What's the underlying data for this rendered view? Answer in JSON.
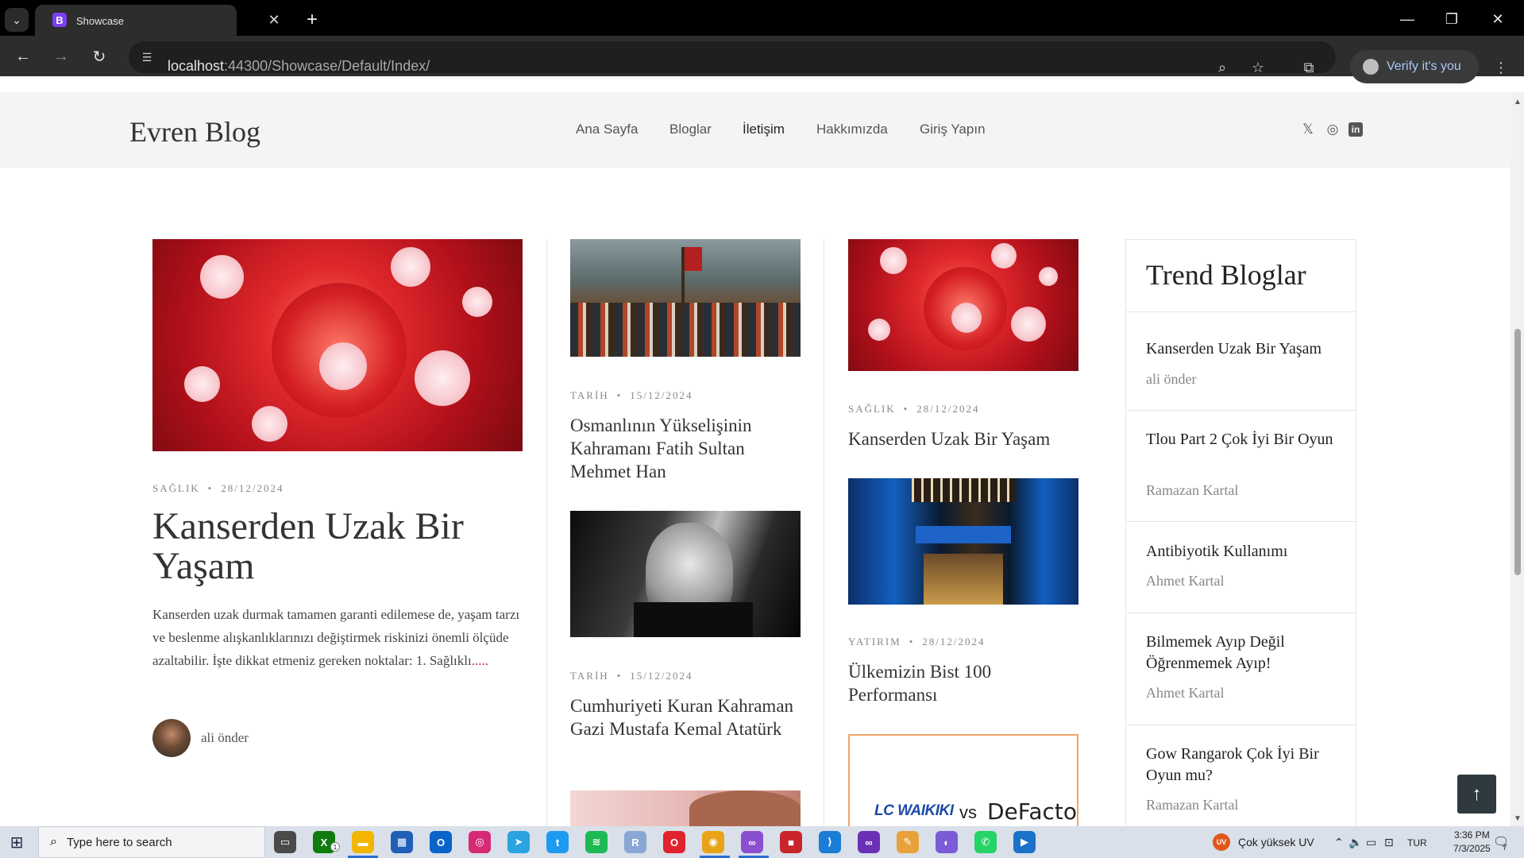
{
  "browser": {
    "tab_title": "Showcase",
    "tab_favicon": "B",
    "url_host": "localhost",
    "url_rest": ":44300/Showcase/Default/Index/",
    "verify_label": "Verify it's you",
    "icons": [
      "tab-search-icon",
      "close-icon",
      "new-tab-icon",
      "minimize-icon",
      "restore-icon",
      "window-close-icon",
      "back-icon",
      "forward-icon",
      "reload-icon",
      "site-info-icon",
      "zoom-icon",
      "bookmark-star-icon",
      "extensions-icon",
      "kebab-menu-icon"
    ]
  },
  "site": {
    "logo": "Evren Blog",
    "menu": [
      "Ana Sayfa",
      "Bloglar",
      "İletişim",
      "Hakkımızda",
      "Giriş Yapın"
    ],
    "social_icons": [
      "x-twitter-icon",
      "instagram-icon",
      "linkedin-icon"
    ]
  },
  "featured": {
    "category": "SAĞLIK",
    "date": "28/12/2024",
    "title": "Kanserden Uzak Bir Yaşam",
    "excerpt": "Kanserden uzak durmak tamamen garanti edilemese de, yaşam tarzı ve beslenme alışkanlıklarınızı değiştirmek riskinizi önemli ölçüde azaltabilir. İşte dikkat etmeniz gereken noktalar: 1. Sağlıklı",
    "more": ".....",
    "author": "ali önder"
  },
  "col2": [
    {
      "category": "TARİH",
      "date": "15/12/2024",
      "title": "Osmanlının Yükselişinin Kahramanı Fatih Sultan Mehmet Han"
    },
    {
      "category": "TARİH",
      "date": "15/12/2024",
      "title": "Cumhuriyeti Kuran Kahraman Gazi Mustafa Kemal Atatürk"
    }
  ],
  "col3": [
    {
      "category": "SAĞLIK",
      "date": "28/12/2024",
      "title": "Kanserden Uzak Bir Yaşam"
    },
    {
      "category": "YATIRIM",
      "date": "28/12/2024",
      "title": "Ülkemizin Bist 100 Performansı"
    }
  ],
  "ad": {
    "left": "LC WAIKIKI",
    "vs": "vs",
    "right": "DeFacto"
  },
  "sidebar": {
    "title": "Trend Bloglar",
    "posts": [
      {
        "title": "Kanserden Uzak Bir Yaşam",
        "author": "ali önder"
      },
      {
        "title": "Tlou Part 2 Çok İyi Bir Oyun",
        "author": "Ramazan Kartal"
      },
      {
        "title": "Antibiyotik Kullanımı",
        "author": "Ahmet Kartal"
      },
      {
        "title": "Bilmemek Ayıp Değil Öğrenmemek Ayıp!",
        "author": "Ahmet Kartal"
      },
      {
        "title": "Gow Rangarok Çok İyi Bir Oyun mu?",
        "author": "Ramazan Kartal"
      }
    ]
  },
  "taskbar": {
    "search_placeholder": "Type here to search",
    "uv_badge": "UV",
    "uv_text": "Çok yüksek UV",
    "lang": "TUR",
    "time": "3:36 PM",
    "date": "7/3/2025",
    "notif_count": "7",
    "xbox_badge": "1",
    "apps": [
      {
        "name": "task-view-icon",
        "color": "#4a4a4a",
        "glyph": "▭"
      },
      {
        "name": "xbox-icon",
        "color": "#107c10",
        "glyph": "X"
      },
      {
        "name": "file-explorer-icon",
        "color": "#f2b600",
        "glyph": "▬"
      },
      {
        "name": "store-icon",
        "color": "#1f5fb8",
        "glyph": "▦"
      },
      {
        "name": "outlook-icon",
        "color": "#0a64c8",
        "glyph": "O"
      },
      {
        "name": "instagram-app-icon",
        "color": "#d62976",
        "glyph": "◎"
      },
      {
        "name": "telegram-icon",
        "color": "#2aa3e0",
        "glyph": "➤"
      },
      {
        "name": "twitter-app-icon",
        "color": "#1d9bf0",
        "glyph": "t"
      },
      {
        "name": "spotify-icon",
        "color": "#1db954",
        "glyph": "≋"
      },
      {
        "name": "r-app-icon",
        "color": "#8aa6d6",
        "glyph": "R"
      },
      {
        "name": "opera-icon",
        "color": "#e0232d",
        "glyph": "O"
      },
      {
        "name": "chrome-icon",
        "color": "#e8a317",
        "glyph": "◉"
      },
      {
        "name": "visual-studio-icon",
        "color": "#8a4fd1",
        "glyph": "∞"
      },
      {
        "name": "red-app-icon",
        "color": "#c9252b",
        "glyph": "■"
      },
      {
        "name": "vscode-icon",
        "color": "#1a7ed6",
        "glyph": "⟩"
      },
      {
        "name": "visual-studio-2-icon",
        "color": "#6b2fb5",
        "glyph": "∞"
      },
      {
        "name": "paint-icon",
        "color": "#e9a23b",
        "glyph": "✎"
      },
      {
        "name": "arc-icon",
        "color": "#7b5bd6",
        "glyph": "◐"
      },
      {
        "name": "whatsapp-icon",
        "color": "#25d366",
        "glyph": "✆"
      },
      {
        "name": "prime-video-icon",
        "color": "#1a73c9",
        "glyph": "▶"
      }
    ]
  }
}
